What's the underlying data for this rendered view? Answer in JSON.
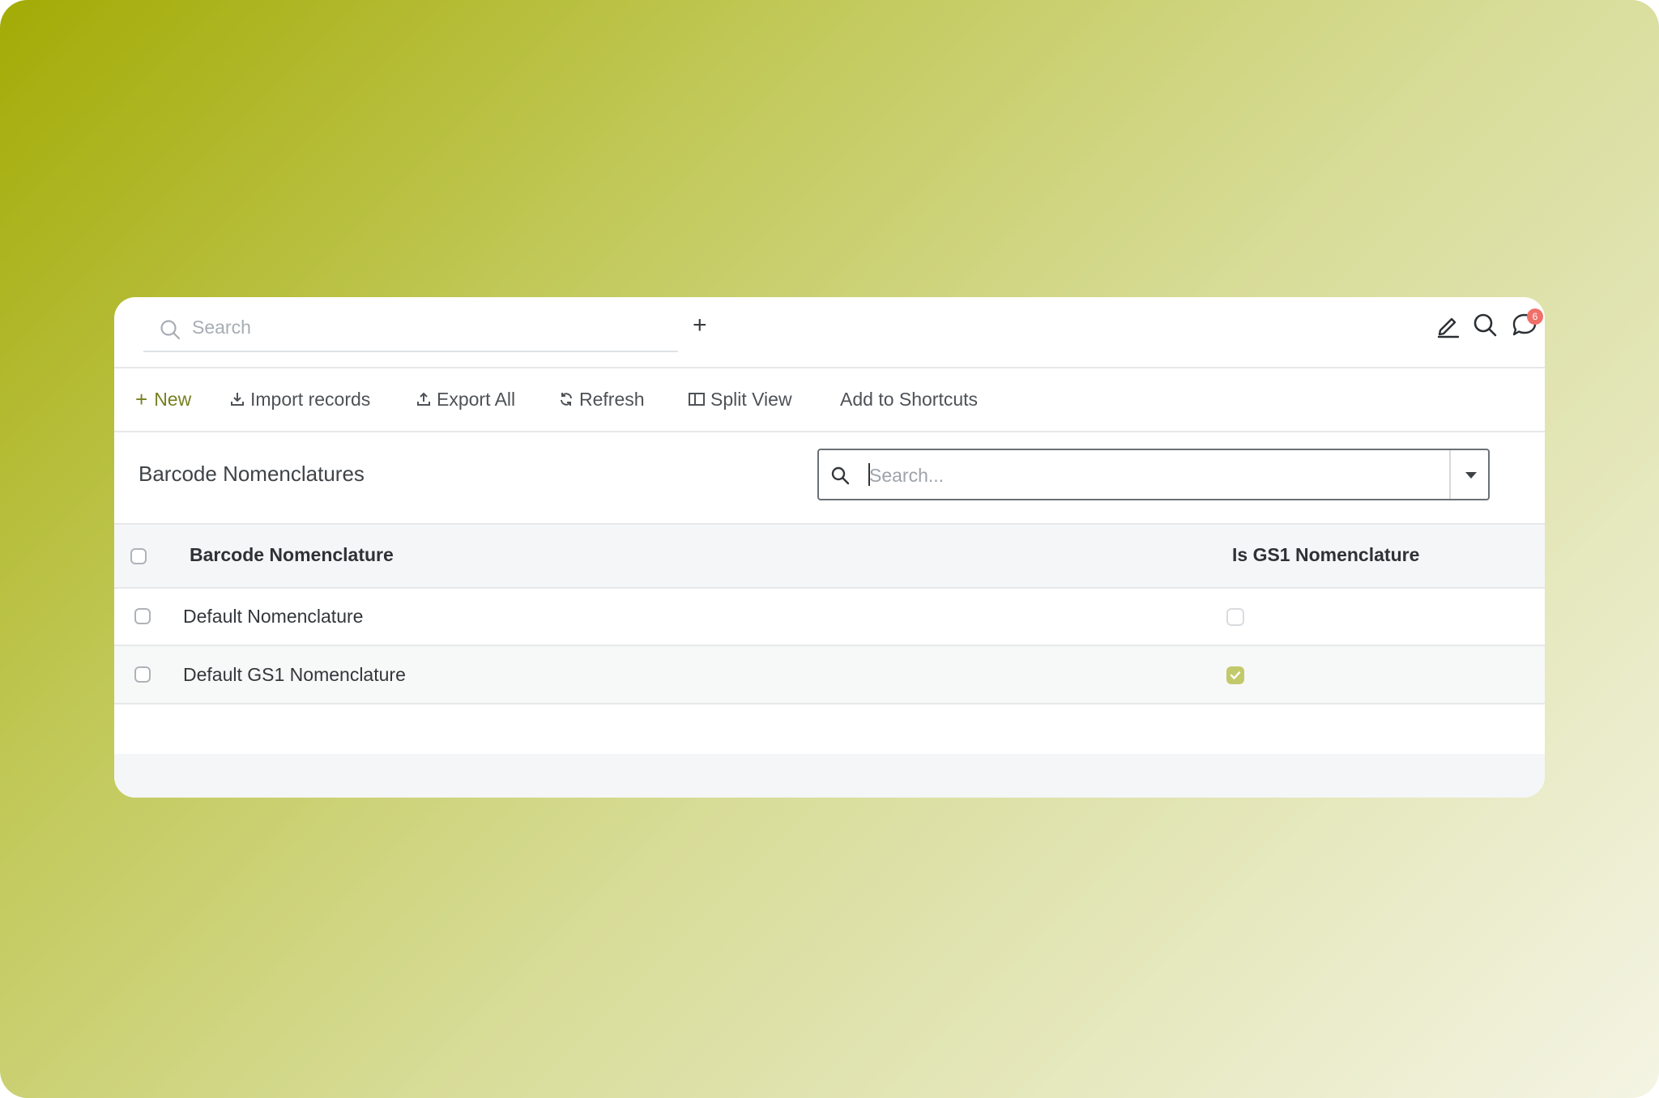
{
  "topbar": {
    "search_placeholder": "Search",
    "add_label": "+",
    "notification_count": "6",
    "icons": [
      "pencil-icon",
      "search-icon",
      "chat-bubble-icon"
    ]
  },
  "toolbar": {
    "new_label": "New",
    "import_label": "Import records",
    "export_label": "Export All",
    "refresh_label": "Refresh",
    "split_view_label": "Split View",
    "shortcuts_label": "Add to Shortcuts",
    "accent_color": "#76801f"
  },
  "list": {
    "title": "Barcode Nomenclatures",
    "search_placeholder": "Search...",
    "columns": [
      "Barcode Nomenclature",
      "Is GS1 Nomenclature"
    ],
    "rows": [
      {
        "name": "Default Nomenclature",
        "is_gs1": false
      },
      {
        "name": "Default GS1 Nomenclature",
        "is_gs1": true
      }
    ]
  },
  "colors": {
    "background_start": "#a3ab06",
    "background_end": "#f4f4e4",
    "checked": "#c2c96a",
    "badge": "#f07069"
  }
}
